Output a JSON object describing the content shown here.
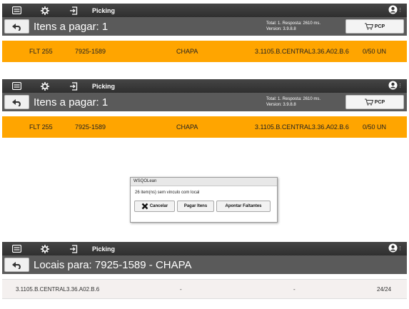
{
  "topbar": {
    "icons": [
      "list-icon",
      "gear-icon",
      "logout-icon",
      "user-icon"
    ],
    "title": "Picking"
  },
  "screen1": {
    "subtitle": "Itens a pagar: 1",
    "info_line1": "Total: 1. Resposta: 2610 ms.",
    "info_line2": "Version: 3.9.8.8",
    "pcp_label": "PCP",
    "row": {
      "code": "FLT 255",
      "part": "7925-1589",
      "desc": "CHAPA",
      "location": "3.1105.B.CENTRAL3.36.A02.B.6",
      "qty": "0/50 UN"
    }
  },
  "screen2": {
    "subtitle": "Itens a pagar: 1",
    "info_line1": "Total: 1. Resposta: 2610 ms.",
    "info_line2": "Version: 3.9.8.8",
    "pcp_label": "PCP",
    "row": {
      "code": "FLT 255",
      "part": "7925-1589",
      "desc": "CHAPA",
      "location": "3.1105.B.CENTRAL3.36.A02.B.6",
      "qty": "0/50 UN"
    },
    "dialog": {
      "title": "WSQOLean",
      "message": "26 item(ns) sem vinculo com local",
      "cancel": "Cancelar",
      "pay": "Pagar Itens",
      "missing": "Apontar Faltantes"
    }
  },
  "screen3": {
    "subtitle": "Locais para: 7925-1589 - CHAPA",
    "row": {
      "location": "3.1105.B.CENTRAL3.36.A02.B.6",
      "col2": "-",
      "col3": "-",
      "qty": "24/24"
    }
  },
  "colors": {
    "topbar": "#3a3a3a",
    "subbar": "#5a5a5a",
    "highlight_row": "#ffa500",
    "location_row": "#f4f0ef"
  }
}
